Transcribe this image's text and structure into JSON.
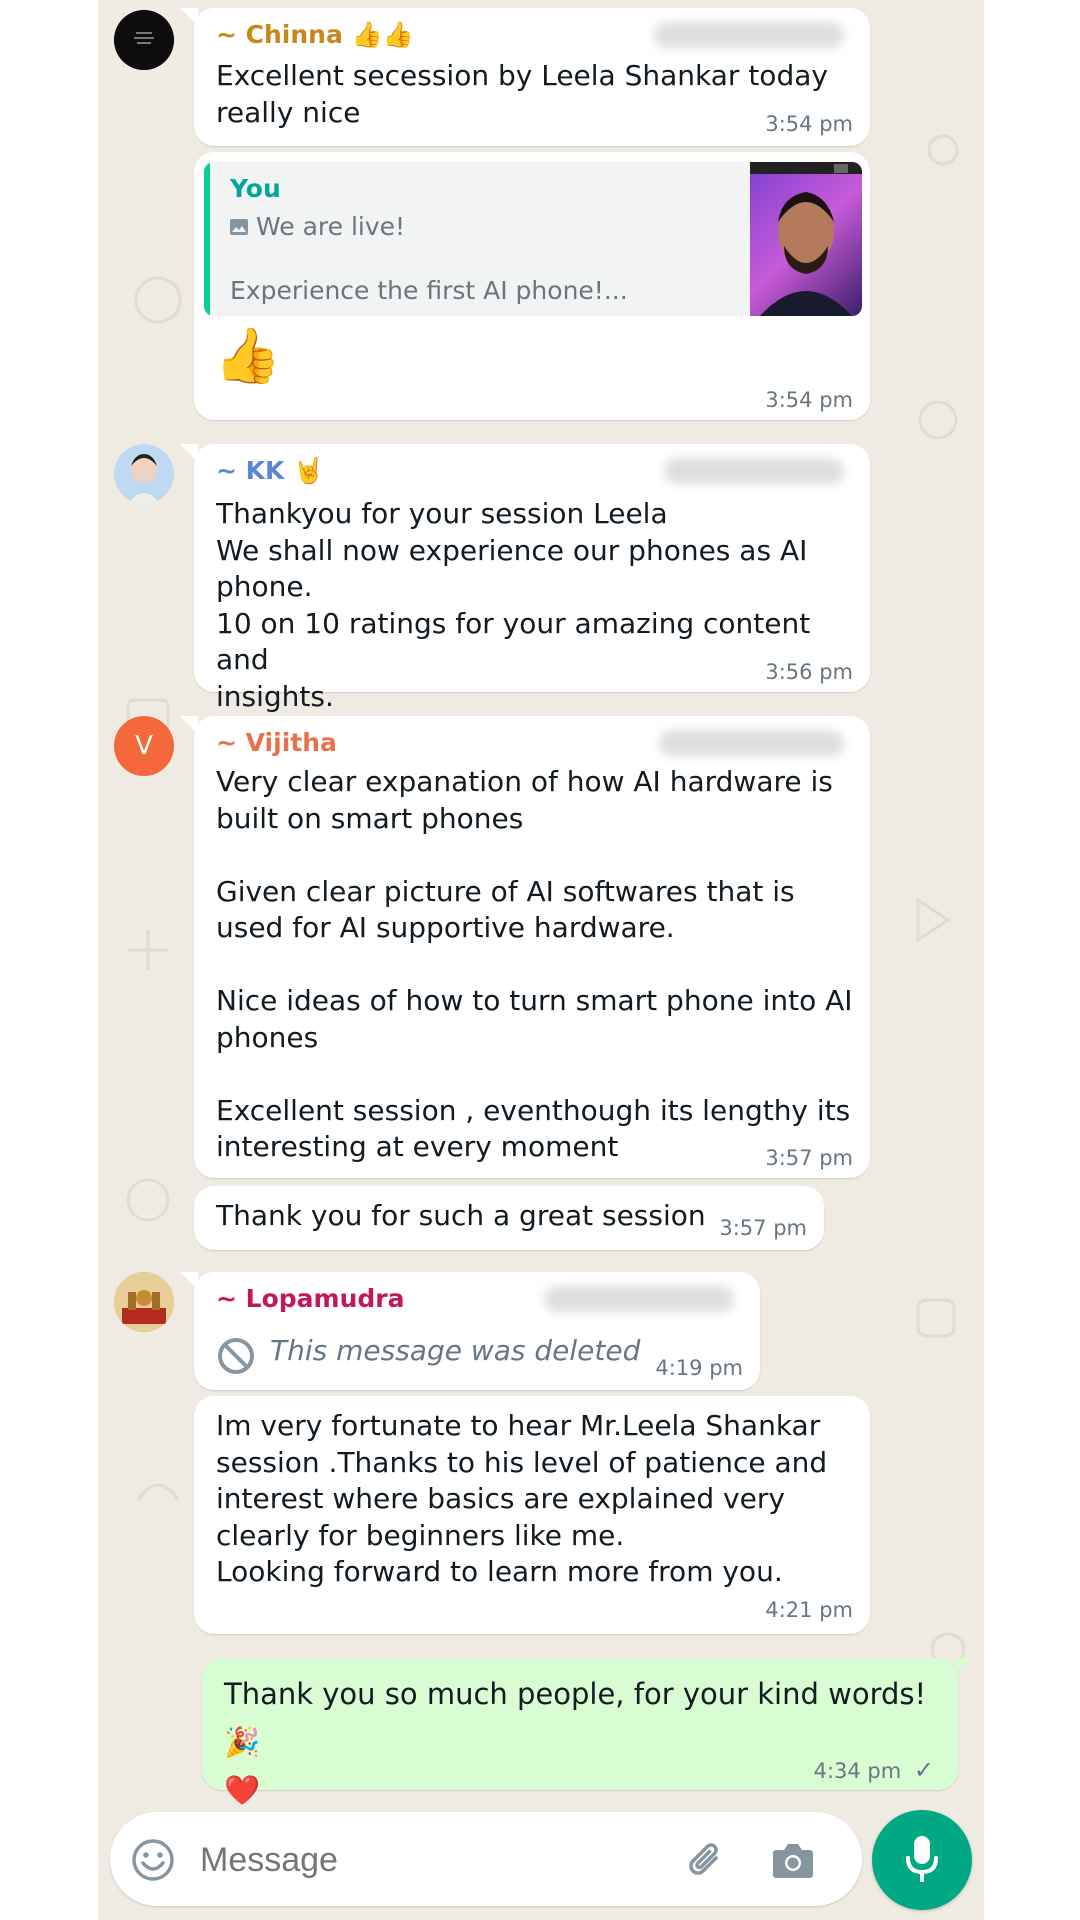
{
  "messages": [
    {
      "sender": "~ Chinna 👍👍",
      "text": "Excellent secession by Leela Shankar today\nreally nice",
      "time": "3:54 pm"
    },
    {
      "quote": {
        "sender": "You",
        "line1": "We are live!",
        "line2": "Experience the first AI phone!..."
      },
      "emoji": "👍",
      "time": "3:54 pm"
    },
    {
      "sender": "~ KK 🤘",
      "text": "Thankyou for your session Leela\nWe shall now experience our phones as AI\nphone.\n10 on 10 ratings for your amazing content and\ninsights.",
      "time": "3:56 pm"
    },
    {
      "sender": "~ Vijitha",
      "avatar_letter": "V",
      "text": "Very clear expanation of how AI hardware is\nbuilt on smart phones\n\nGiven clear picture of AI softwares that is\nused for AI supportive hardware.\n\nNice ideas of how to turn  smart phone into AI\nphones\n\nExcellent session , eventhough its lengthy its\ninteresting at every moment",
      "time": "3:57 pm"
    },
    {
      "text": "Thank you for such a great session",
      "time": "3:57 pm"
    },
    {
      "sender": "~ Lopamudra",
      "deleted_text": "This message was deleted",
      "time": "4:19 pm"
    },
    {
      "text": "Im very fortunate to hear Mr.Leela Shankar\nsession .Thanks to his level of patience and\ninterest where basics are explained very\nclearly for beginners like me.\nLooking forward to learn more from you.",
      "time": "4:21 pm"
    },
    {
      "text": "Thank you so much people, for your kind words! 🎉\n❤️",
      "time": "4:34 pm",
      "status": "✓"
    }
  ],
  "input": {
    "placeholder": "Message"
  },
  "colors": {
    "chinna": "#c88719",
    "kk": "#5b87d6",
    "vijitha": "#e8704e",
    "lopamudra": "#c2185b",
    "you": "#02a698",
    "accent": "#00a884",
    "outgoing_bubble": "#d9fdd3"
  },
  "icons": [
    "emoji-icon",
    "attach-icon",
    "camera-icon",
    "mic-icon",
    "blocked-icon",
    "image-icon",
    "read-tick-icon"
  ]
}
